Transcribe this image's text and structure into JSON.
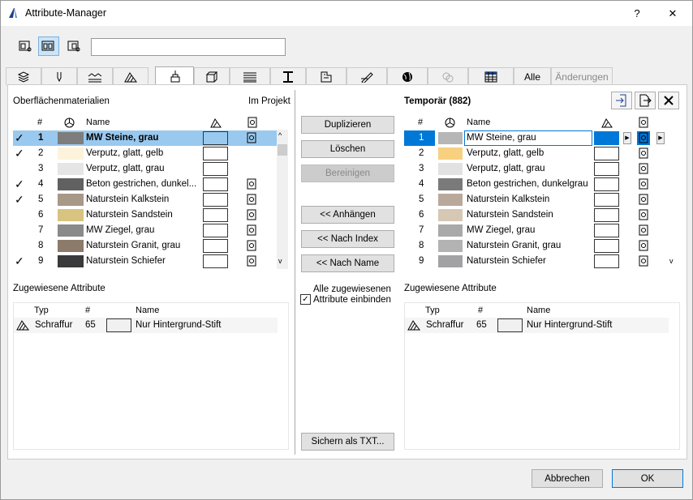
{
  "window": {
    "title": "Attribute-Manager",
    "help": "?",
    "close": "✕"
  },
  "toolbar": {
    "search_value": ""
  },
  "tabs": [
    "Alle",
    "Änderungen"
  ],
  "left": {
    "header_title": "Oberflächenmaterialien",
    "header_right": "Im Projekt",
    "columns": {
      "num": "#",
      "name": "Name"
    },
    "rows": [
      {
        "check": "✓",
        "num": "1",
        "name": "MW Steine, grau",
        "color": "#7d7d7d",
        "selected": true,
        "pin": true
      },
      {
        "check": "✓",
        "num": "2",
        "name": "Verputz, glatt, gelb",
        "color": "#fdf3dc",
        "pin": false
      },
      {
        "check": "",
        "num": "3",
        "name": "Verputz, glatt, grau",
        "color": "#e5e5e5",
        "pin": false
      },
      {
        "check": "✓",
        "num": "4",
        "name": "Beton gestrichen, dunkel...",
        "color": "#616161",
        "pin": true
      },
      {
        "check": "✓",
        "num": "5",
        "name": "Naturstein Kalkstein",
        "color": "#a89888",
        "pin": true
      },
      {
        "check": "",
        "num": "6",
        "name": "Naturstein Sandstein",
        "color": "#d8c381",
        "pin": true
      },
      {
        "check": "",
        "num": "7",
        "name": "MW Ziegel, grau",
        "color": "#8a8a8a",
        "pin": true
      },
      {
        "check": "",
        "num": "8",
        "name": "Naturstein Granit, grau",
        "color": "#8c7b6b",
        "pin": true
      },
      {
        "check": "✓",
        "num": "9",
        "name": "Naturstein Schiefer",
        "color": "#3a3a3c",
        "pin": true
      }
    ],
    "assigned_title": "Zugewiesene Attribute",
    "assigned_cols": {
      "type": "Typ",
      "num": "#",
      "name": "Name"
    },
    "assigned_rows": [
      {
        "type": "Schraffur",
        "num": "65",
        "name": "Nur Hintergrund-Stift"
      }
    ]
  },
  "middle": {
    "duplicate": "Duplizieren",
    "delete": "Löschen",
    "purge": "Bereinigen",
    "append": "<< Anhängen",
    "by_index": "<< Nach Index",
    "by_name": "<< Nach Name",
    "include_all": "Alle zugewiesenen Attribute einbinden",
    "include_checked": true,
    "save_txt": "Sichern als TXT..."
  },
  "right": {
    "header_title": "Temporär (882)",
    "columns": {
      "num": "#",
      "name": "Name"
    },
    "rows": [
      {
        "num": "1",
        "name": "MW Steine, grau",
        "color": "#b6b6b6",
        "selected": true
      },
      {
        "num": "2",
        "name": "Verputz, glatt, gelb",
        "color": "#f7d080"
      },
      {
        "num": "3",
        "name": "Verputz, glatt, grau",
        "color": "#e2e2e2"
      },
      {
        "num": "4",
        "name": "Beton gestrichen, dunkelgrau",
        "color": "#7a7a7a"
      },
      {
        "num": "5",
        "name": "Naturstein Kalkstein",
        "color": "#b9a99b"
      },
      {
        "num": "6",
        "name": "Naturstein Sandstein",
        "color": "#d6c8b5"
      },
      {
        "num": "7",
        "name": "MW Ziegel, grau",
        "color": "#a9a9a9"
      },
      {
        "num": "8",
        "name": "Naturstein Granit, grau",
        "color": "#b3b3b3"
      },
      {
        "num": "9",
        "name": "Naturstein Schiefer",
        "color": "#a2a2a4"
      }
    ],
    "assigned_title": "Zugewiesene Attribute",
    "assigned_cols": {
      "type": "Typ",
      "num": "#",
      "name": "Name"
    },
    "assigned_rows": [
      {
        "type": "Schraffur",
        "num": "65",
        "name": "Nur Hintergrund-Stift"
      }
    ]
  },
  "footer": {
    "cancel": "Abbrechen",
    "ok": "OK"
  },
  "colors": {
    "selection": "#99c9ef",
    "accent": "#0078d7"
  }
}
